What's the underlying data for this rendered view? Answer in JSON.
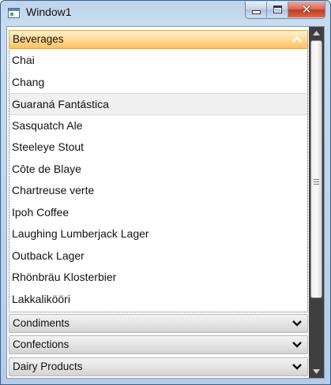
{
  "window": {
    "title": "Window1",
    "controls": {
      "minimize": "minimize",
      "maximize": "maximize",
      "close": "✕"
    }
  },
  "expander": {
    "expanded_group": {
      "header": "Beverages",
      "items": [
        "Chai",
        "Chang",
        "Guaraná Fantástica",
        "Sasquatch Ale",
        "Steeleye Stout",
        "Côte de Blaye",
        "Chartreuse verte",
        "Ipoh Coffee",
        "Laughing Lumberjack Lager",
        "Outback Lager",
        "Rhönbräu Klosterbier",
        "Lakkalikööri"
      ],
      "selected_index": 2
    },
    "collapsed_groups": [
      "Condiments",
      "Confections",
      "Dairy Products"
    ]
  },
  "colors": {
    "expanded_header": "#ffd98f",
    "collapsed_header": "#e3e3e3",
    "scrollbar_track": "#3f3f3f",
    "title_bar": "#c9dcee",
    "close_button": "#c23c21"
  },
  "icons": {
    "expanded_chevron": "chevron-up-icon",
    "collapsed_chevron": "chevron-down-icon",
    "app": "window-app-icon"
  }
}
